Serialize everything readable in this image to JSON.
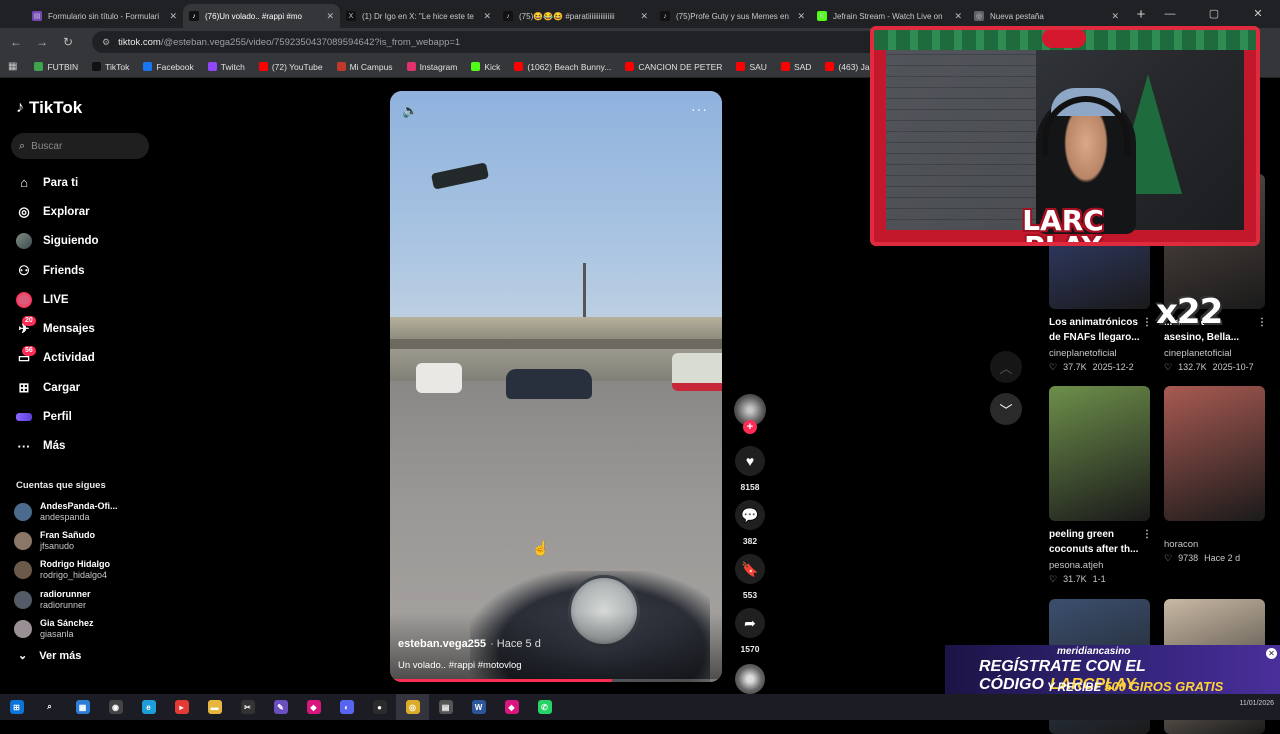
{
  "browser": {
    "tabs": [
      {
        "title": "Formulario sin título - Formulari",
        "color": "#7248b9",
        "glyph": "▤",
        "active": false
      },
      {
        "title": "(76)Un volado.. #rappi #mo",
        "color": "#111111",
        "glyph": "♪",
        "active": true
      },
      {
        "title": "(1) Dr Igo en X: \"Le hice este te",
        "color": "#111111",
        "glyph": "X",
        "active": false
      },
      {
        "title": "(75)😆😂😆 #paratiiiiiiiiiiiiiii",
        "color": "#111111",
        "glyph": "♪",
        "active": false
      },
      {
        "title": "(75)Profe Guty y sus Memes en",
        "color": "#111111",
        "glyph": "♪",
        "active": false
      },
      {
        "title": "Jefrain Stream - Watch Live on",
        "color": "#53fc18",
        "glyph": "K",
        "active": false
      },
      {
        "title": "Nueva pestaña",
        "color": "#5f6368",
        "glyph": "◎",
        "active": false
      }
    ],
    "url_host": "tiktok.com",
    "url_path": "/@esteban.vega255/video/7592350437089594642?is_from_webapp=1",
    "bookmarks": [
      {
        "label": "FUTBIN",
        "color": "#3fa34d"
      },
      {
        "label": "TikTok",
        "color": "#111111"
      },
      {
        "label": "Facebook",
        "color": "#1877f2"
      },
      {
        "label": "Twitch",
        "color": "#9146ff"
      },
      {
        "label": "(72) YouTube",
        "color": "#ff0000"
      },
      {
        "label": "Mi Campus",
        "color": "#c0392b"
      },
      {
        "label": "Instagram",
        "color": "#e1306c"
      },
      {
        "label": "Kick",
        "color": "#53fc18"
      },
      {
        "label": "(1062) Beach Bunny...",
        "color": "#ff0000"
      },
      {
        "label": "CANCION DE PETER",
        "color": "#ff0000"
      },
      {
        "label": "SAU",
        "color": "#ff0000"
      },
      {
        "label": "SAD",
        "color": "#ff0000"
      },
      {
        "label": "(463) James Arthur -...",
        "color": "#ff0000"
      }
    ]
  },
  "tiktok": {
    "brand": "TikTok",
    "search_placeholder": "Buscar",
    "nav": [
      {
        "id": "para-ti",
        "label": "Para ti",
        "icon": "home-icon",
        "glyph": "⌂",
        "badge": ""
      },
      {
        "id": "explorar",
        "label": "Explorar",
        "icon": "compass-icon",
        "glyph": "◎",
        "badge": ""
      },
      {
        "id": "siguiendo",
        "label": "Siguiendo",
        "icon": "following-avatar-icon",
        "glyph": "",
        "badge": ""
      },
      {
        "id": "friends",
        "label": "Friends",
        "icon": "friends-icon",
        "glyph": "⚇",
        "badge": ""
      },
      {
        "id": "live",
        "label": "LIVE",
        "icon": "live-icon",
        "glyph": "",
        "badge": ""
      },
      {
        "id": "mensajes",
        "label": "Mensajes",
        "icon": "messages-icon",
        "glyph": "✈",
        "badge": "20"
      },
      {
        "id": "actividad",
        "label": "Actividad",
        "icon": "activity-icon",
        "glyph": "▭",
        "badge": "56"
      },
      {
        "id": "cargar",
        "label": "Cargar",
        "icon": "upload-icon",
        "glyph": "⊞",
        "badge": ""
      },
      {
        "id": "perfil",
        "label": "Perfil",
        "icon": "profile-icon",
        "glyph": "",
        "badge": ""
      },
      {
        "id": "mas",
        "label": "Más",
        "icon": "more-icon",
        "glyph": "···",
        "badge": ""
      }
    ],
    "following_header": "Cuentas que sigues",
    "following": [
      {
        "name": "AndesPanda-Ofi...",
        "handle": "andespanda",
        "color": "#4c6a8c"
      },
      {
        "name": "Fran Sañudo",
        "handle": "jfsanudo",
        "color": "#8a7767"
      },
      {
        "name": "Rodrigo Hidalgo",
        "handle": "rodrigo_hidalgo4",
        "color": "#6b5a4a"
      },
      {
        "name": "radiorunner",
        "handle": "radiorunner",
        "color": "#555b66"
      },
      {
        "name": "Gia Sánchez",
        "handle": "giasanla",
        "color": "#9a8f95"
      }
    ],
    "ver_mas": "Ver más"
  },
  "video": {
    "author": "esteban.vega255",
    "time": "· Hace 5 d",
    "caption": "Un volado.. #rappi #motovlog",
    "progress_fraction": 0.67,
    "likes": "8158",
    "comments": "382",
    "saves": "553",
    "shares": "1570"
  },
  "related": [
    {
      "title": "Los animatrónicos de FNAFs llegaro...",
      "author": "cineplanetoficial",
      "likes": "37.7K",
      "date": "2025-12-2",
      "bg": "#3a4a8a"
    },
    {
      "title": "...iel de un asesino, Bella...",
      "author": "cineplanetoficial",
      "likes": "132.7K",
      "date": "2025-10-7",
      "bg": "#5a4e48"
    },
    {
      "title": "peeling green coconuts after th...",
      "author": "pesona.atjeh",
      "likes": "31.7K",
      "date": "1-1",
      "bg": "#6d8f4a"
    },
    {
      "title": "",
      "author": "horacon",
      "likes": "9738",
      "date": "Hace 2 d",
      "bg": "#a85a52"
    },
    {
      "title": "",
      "author": "",
      "likes": "",
      "date": "",
      "bg": "#3b4f6e"
    },
    {
      "title": "",
      "author": "",
      "likes": "",
      "date": "",
      "bg": "#c9b9a4"
    }
  ],
  "overlay": {
    "logo_line1": "LARC",
    "logo_line2": "PLAY",
    "multiplier": "x22",
    "promo_brand": "meridiancasino",
    "promo_line1": "REGÍSTRATE CON EL CÓDIGO",
    "promo_code": "LARCPLAY",
    "promo_line2a": "Y RECIBE",
    "promo_line2b": "500 GIROS GRATIS",
    "tray_date": "11/01/2026"
  },
  "taskbar": {
    "apps": [
      {
        "icon": "windows-start-icon",
        "color": "#0a74da",
        "glyph": "⊞"
      },
      {
        "icon": "search-icon",
        "color": "transparent",
        "glyph": "⌕"
      },
      {
        "icon": "store-icon",
        "color": "#2d7cd6",
        "glyph": "▦"
      },
      {
        "icon": "game-icon",
        "color": "#444",
        "glyph": "◉"
      },
      {
        "icon": "edge-icon",
        "color": "#1e9ed8",
        "glyph": "e"
      },
      {
        "icon": "streamlabs-icon",
        "color": "#e53935",
        "glyph": "▸"
      },
      {
        "icon": "folder-icon",
        "color": "#e6b73c",
        "glyph": "▬"
      },
      {
        "icon": "capcut-icon",
        "color": "#333",
        "glyph": "✂"
      },
      {
        "icon": "lightshot-icon",
        "color": "#6b4fc0",
        "glyph": "✎"
      },
      {
        "icon": "app-icon",
        "color": "#d9167e",
        "glyph": "◆"
      },
      {
        "icon": "discord-icon",
        "color": "#5865f2",
        "glyph": "◐"
      },
      {
        "icon": "obs-icon",
        "color": "#2b2b2b",
        "glyph": "●"
      },
      {
        "icon": "chrome-icon",
        "color": "#dbac2a",
        "glyph": "◎"
      },
      {
        "icon": "calculator-icon",
        "color": "#555",
        "glyph": "▤"
      },
      {
        "icon": "word-icon",
        "color": "#2b579a",
        "glyph": "W"
      },
      {
        "icon": "app2-icon",
        "color": "#d9167e",
        "glyph": "◆"
      },
      {
        "icon": "whatsapp-icon",
        "color": "#25d366",
        "glyph": "✆",
        "badge": "99+"
      }
    ]
  }
}
